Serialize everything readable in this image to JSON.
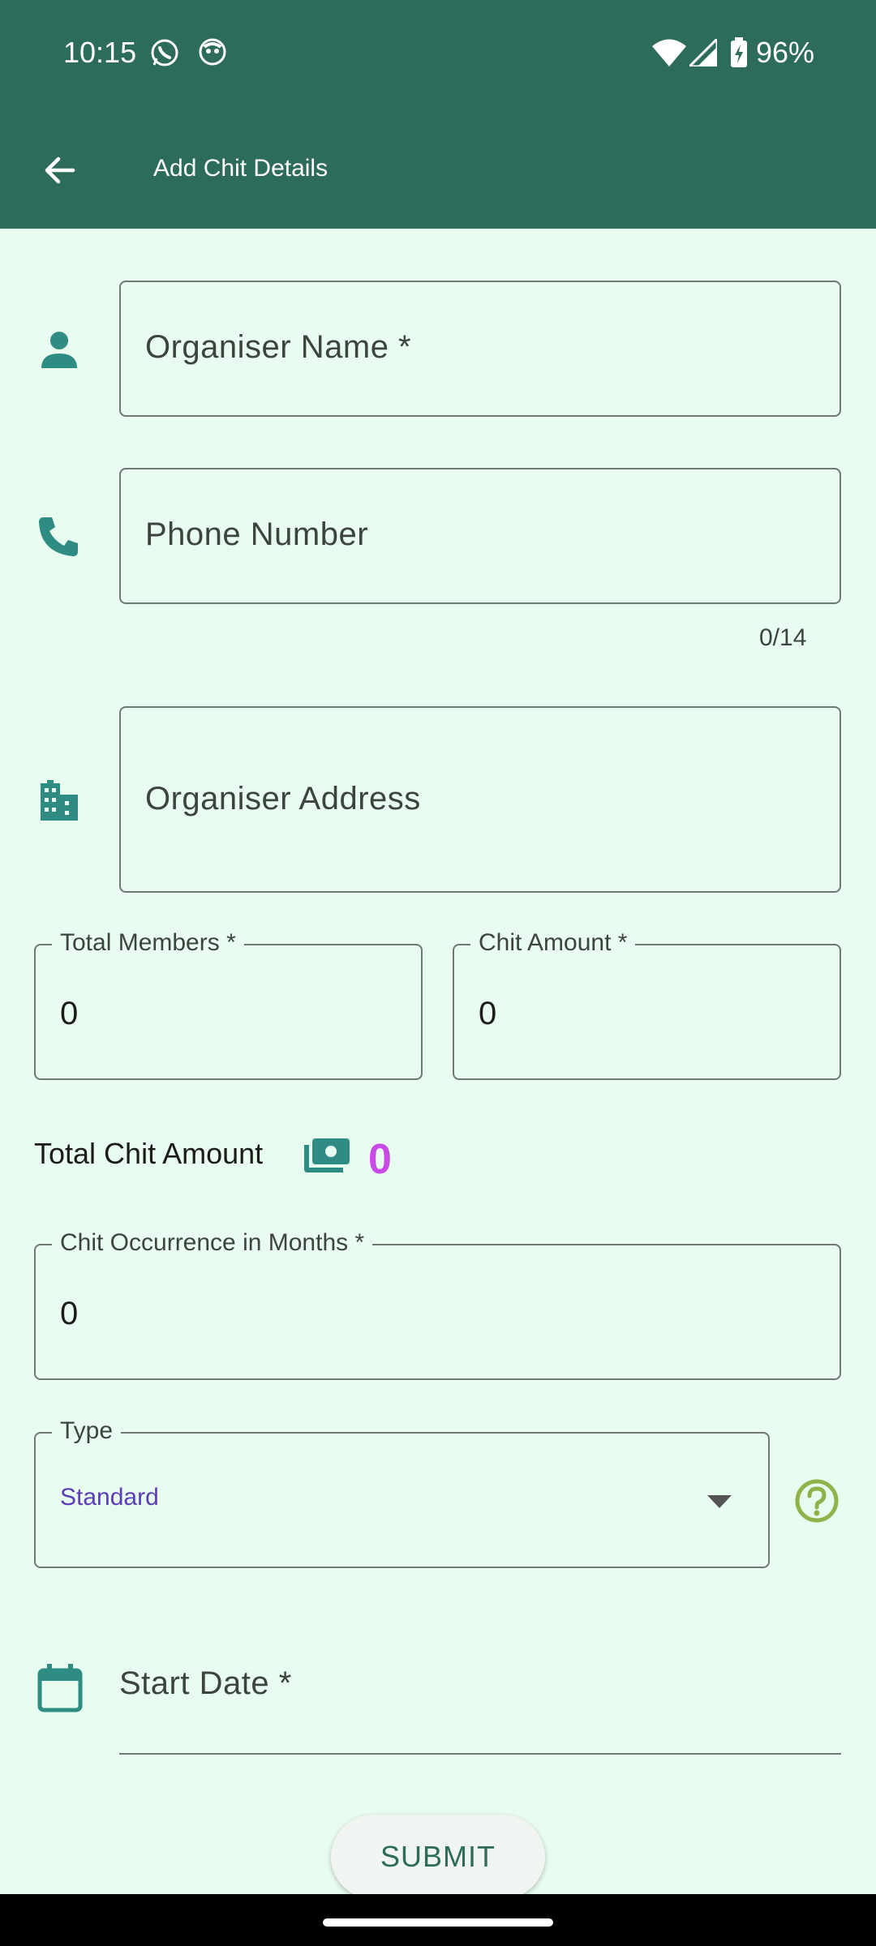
{
  "status_bar": {
    "time": "10:15",
    "battery": "96%",
    "icons": [
      "whatsapp-icon",
      "notification-icon",
      "wifi-icon",
      "signal-icon",
      "battery-charging-icon"
    ]
  },
  "app_bar": {
    "title": "Add Chit Details",
    "back_icon": "arrow-back-icon",
    "color": "#2d6b5a"
  },
  "form": {
    "organiser_name": {
      "placeholder": "Organiser Name *",
      "icon": "person-icon"
    },
    "phone_number": {
      "placeholder": "Phone Number",
      "icon": "phone-icon",
      "counter": "0/14"
    },
    "organiser_address": {
      "placeholder": "Organiser Address",
      "icon": "building-icon"
    },
    "total_members": {
      "label": "Total Members *",
      "value": "0"
    },
    "chit_amount": {
      "label": "Chit Amount *",
      "value": "0"
    },
    "total_chit_amount": {
      "label": "Total Chit Amount",
      "value": "0",
      "icon": "money-icon",
      "value_color": "#c94ae6"
    },
    "chit_occurrence": {
      "label": "Chit Occurrence in Months *",
      "value": "0"
    },
    "type": {
      "label": "Type",
      "value": "Standard",
      "help_icon": "help-circle-icon"
    },
    "start_date": {
      "label": "Start Date *",
      "icon": "calendar-icon"
    }
  },
  "submit_label": "SUBMIT"
}
